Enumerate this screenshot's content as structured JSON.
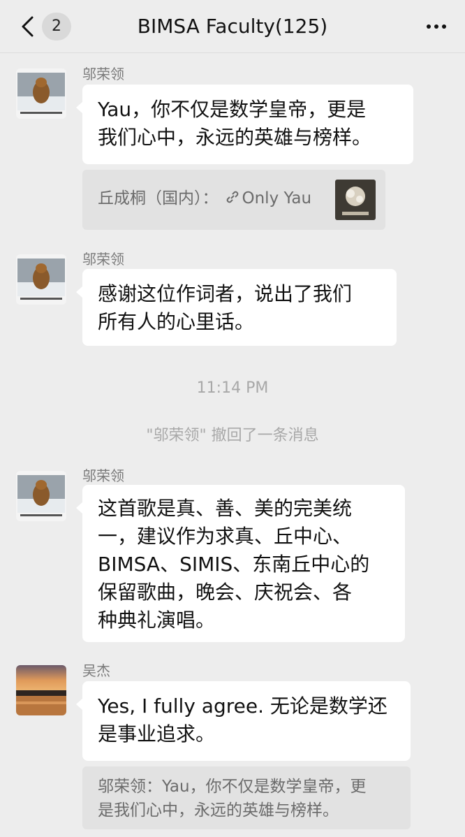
{
  "header": {
    "unread_count": "2",
    "title": "BIMSA Faculty(125)"
  },
  "messages": [
    {
      "sender": "邬荣领",
      "lines": [
        "Yau，你不仅是数学皇帝，更是",
        "我们心中，永远的英雄与榜样。"
      ],
      "quote": {
        "author": "丘成桐（国内）：",
        "link_text": "Only Yau"
      }
    },
    {
      "sender": "邬荣领",
      "lines": [
        "感谢这位作词者，说出了我们",
        "所有人的心里话。"
      ]
    },
    {
      "sender": "邬荣领",
      "lines": [
        "这首歌是真、善、美的完美统",
        "一，建议作为求真、丘中心、",
        "BIMSA、SIMIS、东南丘中心的",
        "保留歌曲，晚会、庆祝会、各",
        "种典礼演唱。"
      ]
    },
    {
      "sender": "吴杰",
      "lines": [
        "Yes, I fully agree. 无论是数学还",
        "是事业追求。"
      ],
      "quote": {
        "lines": [
          "邬荣领：Yau，你不仅是数学皇帝，更",
          "是我们心中，永远的英雄与榜样。"
        ]
      }
    }
  ],
  "system": {
    "time": "11:14 PM",
    "recall_notice": "\"邬荣领\" 撤回了一条消息"
  },
  "colors": {
    "background": "#ededed",
    "bubble": "#ffffff",
    "quote": "#e2e2e2",
    "sender_text": "#7a7a7a",
    "system_text": "#a8a8a8"
  },
  "icons": {
    "back": "chevron-left-icon",
    "more": "more-dots-icon",
    "link": "link-icon"
  }
}
